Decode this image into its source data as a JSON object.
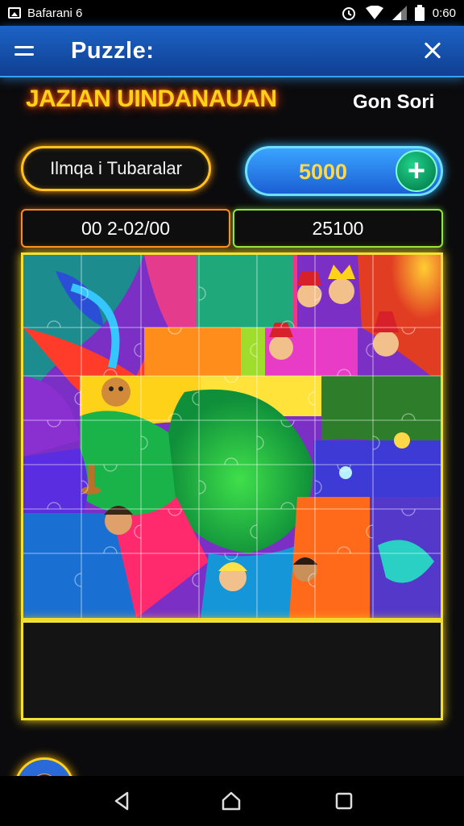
{
  "status_bar": {
    "left_text": "Bafarani 6",
    "time": "0:60",
    "icons": [
      "image-icon",
      "alarm-icon",
      "wifi-icon",
      "signal-icon",
      "battery-icon"
    ]
  },
  "app_bar": {
    "title": "Puzzle:",
    "menu_icon": "hamburger-icon",
    "close_icon": "close-icon",
    "color": "#1c63c6"
  },
  "header": {
    "game_title": "JAZIAN UINDANAUAN",
    "link": "Gon Sori"
  },
  "image_selector": {
    "label": "Ilmqa i Tubaralar"
  },
  "coins": {
    "value": "5000",
    "add_label": "+"
  },
  "stats": {
    "time": "00 2-02/00",
    "score": "25100"
  },
  "colors": {
    "accent_yellow": "#f3e034",
    "accent_orange": "#ff8a1e",
    "accent_green": "#8ee840",
    "coin_blue": "#2f86ef"
  },
  "navigation": {
    "back_icon": "back-triangle-icon",
    "home_icon": "home-icon",
    "recents_icon": "recents-square-icon"
  }
}
